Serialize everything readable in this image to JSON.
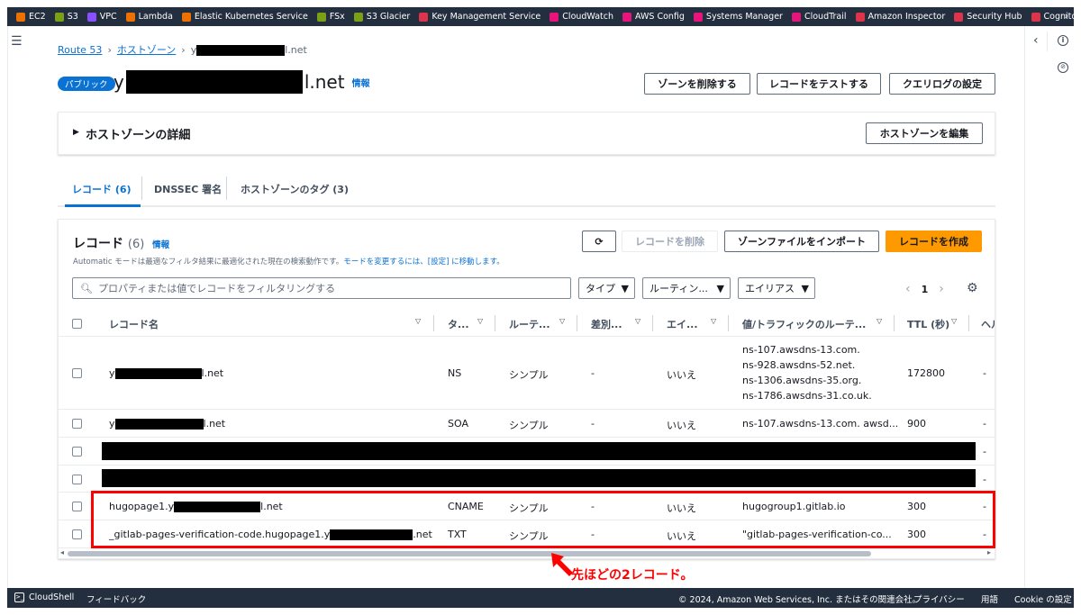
{
  "favorites": [
    {
      "label": "EC2",
      "color": "#ed7100"
    },
    {
      "label": "S3",
      "color": "#7aa116"
    },
    {
      "label": "VPC",
      "color": "#8c4fff"
    },
    {
      "label": "Lambda",
      "color": "#ed7100"
    },
    {
      "label": "Elastic Kubernetes Service",
      "color": "#ed7100"
    },
    {
      "label": "FSx",
      "color": "#7aa116"
    },
    {
      "label": "S3 Glacier",
      "color": "#7aa116"
    },
    {
      "label": "Key Management Service",
      "color": "#dd344c"
    },
    {
      "label": "CloudWatch",
      "color": "#e7157b"
    },
    {
      "label": "AWS Config",
      "color": "#e7157b"
    },
    {
      "label": "Systems Manager",
      "color": "#e7157b"
    },
    {
      "label": "CloudTrail",
      "color": "#e7157b"
    },
    {
      "label": "Amazon Inspector",
      "color": "#dd344c"
    },
    {
      "label": "Security Hub",
      "color": "#dd344c"
    },
    {
      "label": "Cognito",
      "color": "#dd344c"
    }
  ],
  "breadcrumb": {
    "root": "Route 53",
    "zones": "ホストゾーン",
    "current_prefix": "y",
    "current_suffix": "l.net"
  },
  "header": {
    "badge": "パブリック",
    "title_prefix": "y",
    "title_suffix": "l.net",
    "info": "情報",
    "btn_delete_zone": "ゾーンを削除する",
    "btn_test_record": "レコードをテストする",
    "btn_query_log": "クエリログの設定"
  },
  "detail": {
    "title": "ホストゾーンの詳細",
    "edit_button": "ホストゾーンを編集"
  },
  "tabs": [
    {
      "label": "レコード (6)"
    },
    {
      "label": "DNSSEC 署名"
    },
    {
      "label": "ホストゾーンのタグ (3)"
    }
  ],
  "records_panel": {
    "title": "レコード",
    "count": "(6)",
    "info": "情報",
    "description": "Automatic モードは最適なフィルタ結果に最適化された現在の検索動作です。",
    "description_link": "モードを変更するには、[設定] に移動します。",
    "btn_delete": "レコードを削除",
    "btn_import": "ゾーンファイルをインポート",
    "btn_create": "レコードを作成",
    "search_placeholder": "プロパティまたは値でレコードをフィルタリングする",
    "filter_type": "タイプ",
    "filter_routing": "ルーティン...",
    "filter_alias": "エイリアス",
    "page": "1"
  },
  "columns": [
    "レコード名",
    "タ...",
    "ルーテ...",
    "差別...",
    "エイ...",
    "値/トラフィックのルーテ...",
    "TTL (秒)",
    "ヘル"
  ],
  "rows": [
    {
      "name_prefix": "y",
      "name_suffix": "l.net",
      "type": "NS",
      "routing": "シンプル",
      "diff": "-",
      "alias": "いいえ",
      "value_lines": [
        "ns-107.awsdns-13.com.",
        "ns-928.awsdns-52.net.",
        "ns-1306.awsdns-35.org.",
        "ns-1786.awsdns-31.co.uk."
      ],
      "ttl": "172800",
      "health": "-"
    },
    {
      "name_prefix": "y",
      "name_suffix": "l.net",
      "type": "SOA",
      "routing": "シンプル",
      "diff": "-",
      "alias": "いいえ",
      "value": "ns-107.awsdns-13.com. awsd...",
      "ttl": "900",
      "health": "-"
    },
    {
      "health": "-"
    },
    {
      "health": "-"
    },
    {
      "name_prefix": "hugopage1.y",
      "name_suffix": "l.net",
      "type": "CNAME",
      "routing": "シンプル",
      "diff": "-",
      "alias": "いいえ",
      "value": "hugogroup1.gitlab.io",
      "ttl": "300",
      "health": "-"
    },
    {
      "name_prefix": "_gitlab-pages-verification-code.hugopage1.y",
      "name_suffix": ".net",
      "type": "TXT",
      "routing": "シンプル",
      "diff": "-",
      "alias": "いいえ",
      "value": "\"gitlab-pages-verification-co...",
      "ttl": "300",
      "health": "-"
    }
  ],
  "annotation": {
    "text": "先ほどの2レコード。",
    "color": "#ff0000"
  },
  "footer": {
    "cloudshell": "CloudShell",
    "feedback": "フィードバック",
    "copyright": "© 2024, Amazon Web Services, Inc. またはその関連会社。",
    "privacy": "プライバシー",
    "terms": "用語",
    "cookie": "Cookie の設定"
  },
  "colors": {
    "primary": "#0972d3",
    "accent": "#ff9900",
    "nav": "#232f3e",
    "annotation": "#ff0000"
  }
}
